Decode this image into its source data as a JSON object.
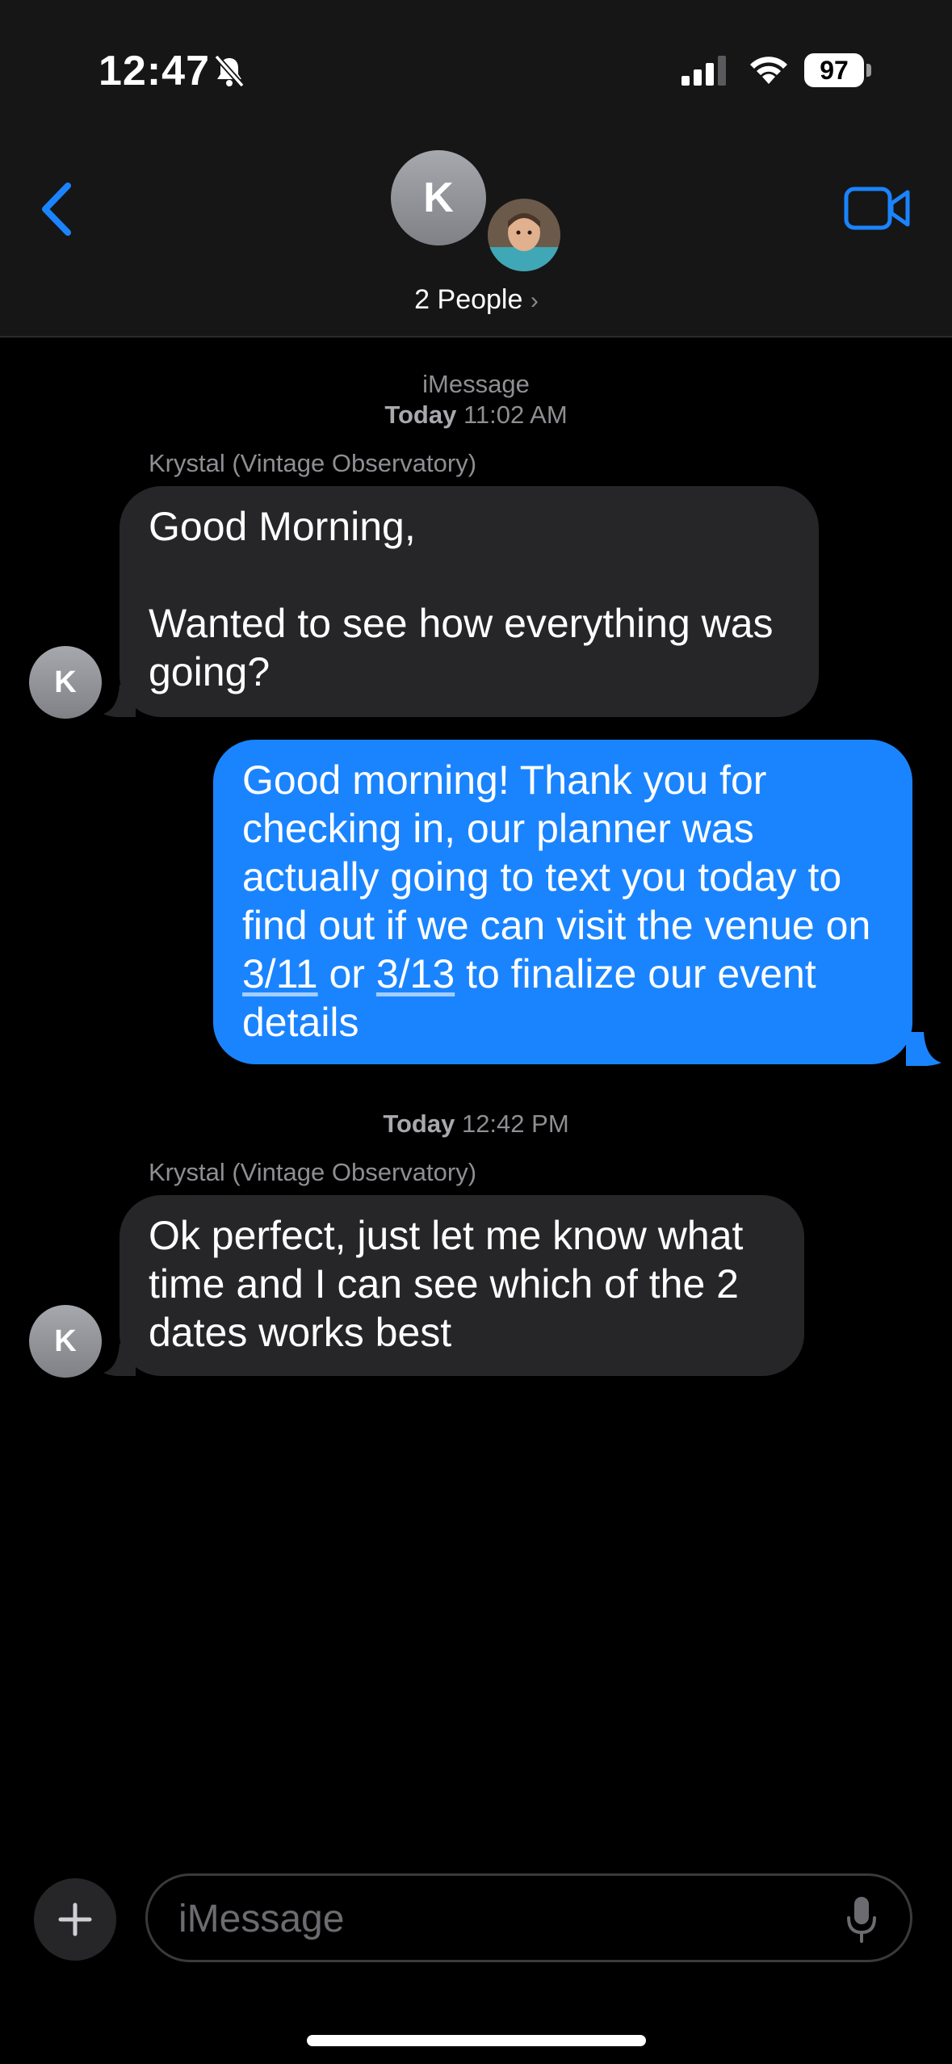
{
  "status_bar": {
    "time": "12:47",
    "battery": "97"
  },
  "header": {
    "group_initial": "K",
    "people_label": "2 People",
    "chevron": "›"
  },
  "conversation": {
    "service_label": "iMessage",
    "timestamp1_day": "Today",
    "timestamp1_time": "11:02 AM",
    "timestamp2_day": "Today",
    "timestamp2_time": "12:42 PM",
    "messages": [
      {
        "sender": "Krystal (Vintage Observatory)",
        "avatar_initial": "K",
        "line1": "Good Morning,",
        "line2": "Wanted to see how everything was going?"
      },
      {
        "text_before": "Good morning! Thank you for checking in, our planner was actually going to text you today to find out if we can visit the venue on ",
        "date1": "3/11",
        "text_mid": " or ",
        "date2": "3/13",
        "text_after": " to finalize our event details"
      },
      {
        "sender": "Krystal (Vintage Observatory)",
        "avatar_initial": "K",
        "text": "Ok perfect, just let me know what time and I can see which of the 2 dates works best"
      }
    ]
  },
  "composer": {
    "placeholder": "iMessage"
  },
  "colors": {
    "accent": "#1a84ff",
    "incoming_bubble": "#262628",
    "outgoing_bubble": "#1a84ff"
  },
  "icons": [
    "bell-slash-icon",
    "cellular-signal-icon",
    "wifi-icon",
    "battery-icon",
    "back-chevron-icon",
    "video-camera-icon",
    "plus-icon",
    "microphone-icon"
  ]
}
